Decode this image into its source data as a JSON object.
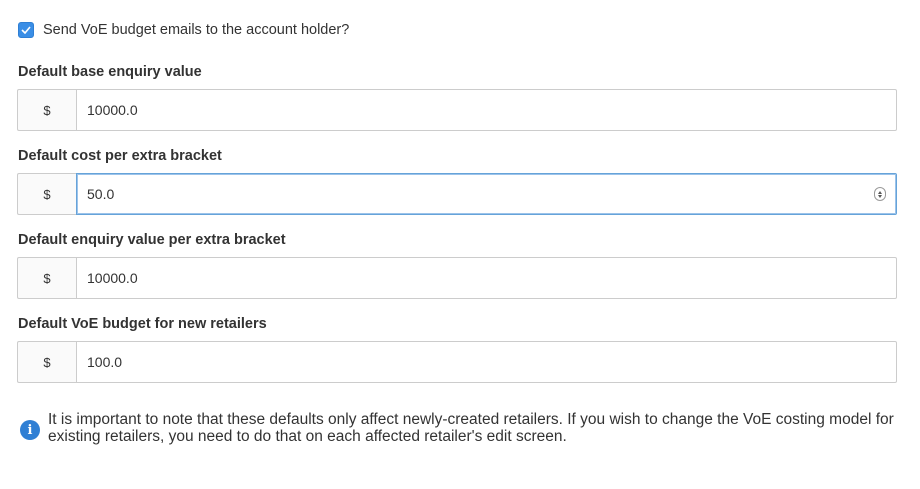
{
  "send_emails": {
    "label": "Send VoE budget emails to the account holder?",
    "checked": true
  },
  "fields": [
    {
      "label": "Default base enquiry value",
      "prefix": "$",
      "value": "10000.0"
    },
    {
      "label": "Default cost per extra bracket",
      "prefix": "$",
      "value": "50.0"
    },
    {
      "label": "Default enquiry value per extra bracket",
      "prefix": "$",
      "value": "10000.0"
    },
    {
      "label": "Default VoE budget for new retailers",
      "prefix": "$",
      "value": "100.0"
    }
  ],
  "info": {
    "icon": "info-icon",
    "text": "It is important to note that these defaults only affect newly-created retailers. If you wish to change the VoE costing model for existing retailers, you need to do that on each affected retailer's edit screen."
  },
  "colors": {
    "accent": "#2f7fd4",
    "focus_border": "#66a3d9",
    "border": "#cccccc"
  }
}
